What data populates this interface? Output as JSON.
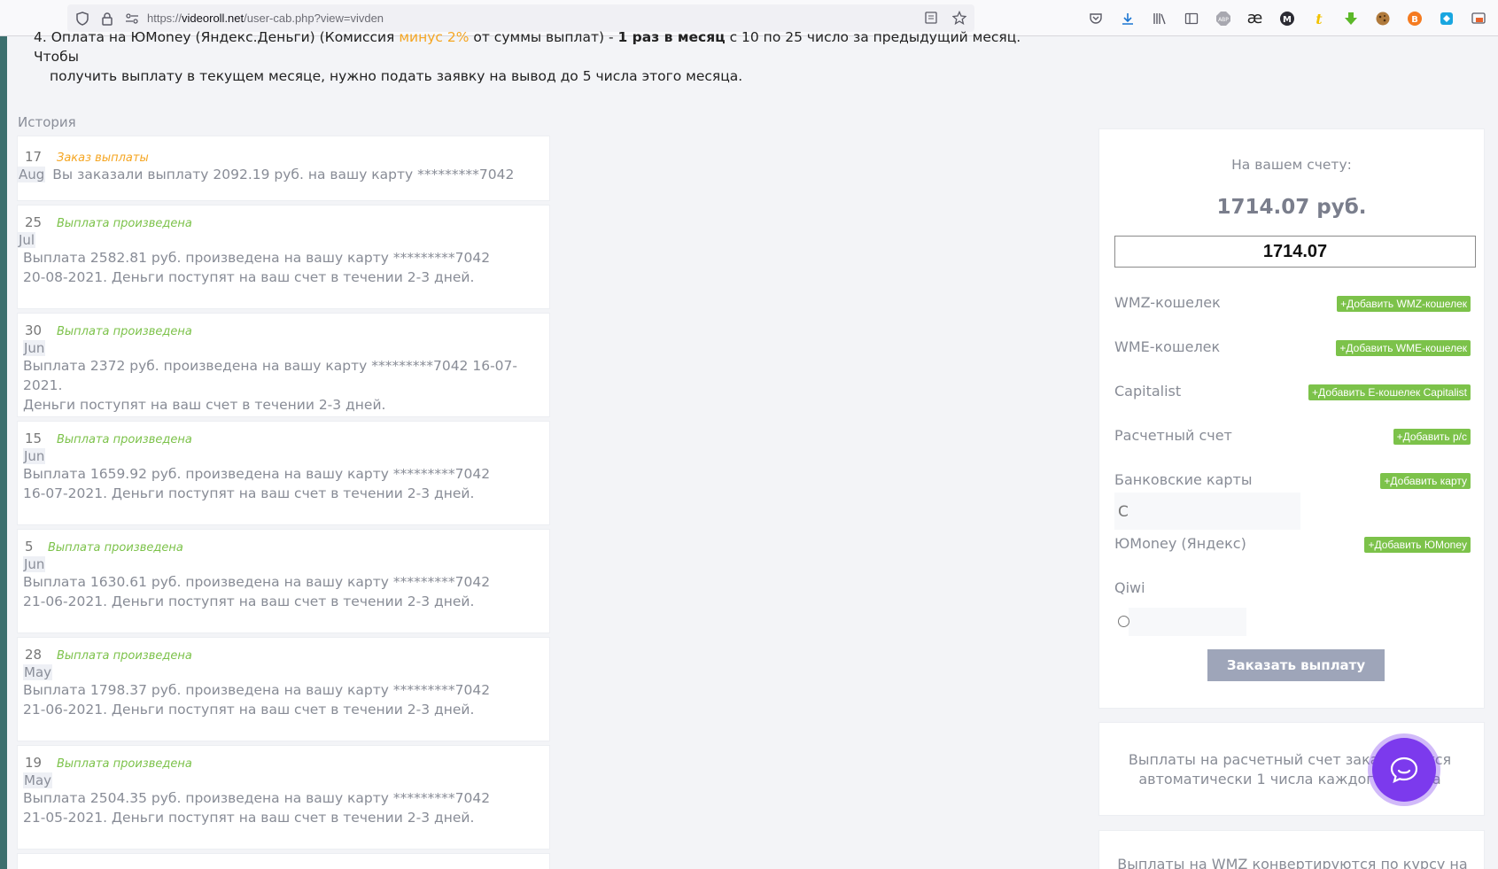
{
  "browser": {
    "url_prefix": "https://",
    "url_domain": "videoroll.net",
    "url_path": "/user-cab.php?view=vivden"
  },
  "notice": {
    "part1": "4. Оплата на ЮMoney (Яндекс.Деньги) (Комиссия ",
    "orange": "минус 2%",
    "part2": " от суммы выплат) - ",
    "bold": "1 раз в месяц",
    "part3": " с 10 по 25 число за предыдущий месяц. Чтобы",
    "line2": "получить выплату в текущем месяце, нужно подать заявку на вывод до 5 числа этого месяца."
  },
  "history": {
    "title": "История",
    "items": [
      {
        "day": "17",
        "month": "Aug",
        "status": "Заказ выплаты",
        "text1": "Вы заказали выплату 2092.19 руб. на вашу карту *********7042",
        "text2": ""
      },
      {
        "day": "25",
        "month": "Jul",
        "status": "Выплата произведена",
        "text1": "Выплата 2582.81 руб. произведена на вашу карту *********7042",
        "text2": "20-08-2021. Деньги поступят на ваш счет в течении 2-3 дней."
      },
      {
        "day": "30",
        "month": "Jun",
        "status": "Выплата произведена",
        "text1": "Выплата 2372 руб. произведена на вашу карту *********7042 16-07-2021.",
        "text2": "Деньги поступят на ваш счет в течении 2-3 дней."
      },
      {
        "day": "15",
        "month": "Jun",
        "status": "Выплата произведена",
        "text1": "Выплата 1659.92 руб. произведена на вашу карту *********7042",
        "text2": "16-07-2021. Деньги поступят на ваш счет в течении 2-3 дней."
      },
      {
        "day": "5",
        "month": "Jun",
        "status": "Выплата произведена",
        "text1": "Выплата 1630.61 руб. произведена на вашу карту *********7042",
        "text2": "21-06-2021. Деньги поступят на ваш счет в течении 2-3 дней."
      },
      {
        "day": "28",
        "month": "May",
        "status": "Выплата произведена",
        "text1": "Выплата 1798.37 руб. произведена на вашу карту *********7042",
        "text2": "21-06-2021. Деньги поступят на ваш счет в течении 2-3 дней."
      },
      {
        "day": "19",
        "month": "May",
        "status": "Выплата произведена",
        "text1": "Выплата 2504.35 руб. произведена на вашу карту *********7042",
        "text2": "21-05-2021. Деньги поступят на ваш счет в течении 2-3 дней."
      }
    ]
  },
  "account": {
    "balance_label": "На вашем счету:",
    "balance_value": "1714.07 руб.",
    "input_value": "1714.07",
    "wallets": [
      {
        "label": "WMZ-кошелек",
        "button": "+Добавить WMZ-кошелек"
      },
      {
        "label": "WME-кошелек",
        "button": "+Добавить WME-кошелек"
      },
      {
        "label": "Capitalist",
        "button": "+Добавить E-кошелек Capitalist"
      },
      {
        "label": "Расчетный счет",
        "button": "+Добавить р/с"
      },
      {
        "label": "Банковские карты",
        "button": "+Добавить карту"
      },
      {
        "label": "ЮMoney (Яндекс)",
        "button": "+Добавить ЮMoney"
      },
      {
        "label": "Qiwi",
        "button": ""
      }
    ],
    "card_radio_label": "С",
    "order_button": "Заказать выплату"
  },
  "info": {
    "card1_line1": "Выплаты на расчетный счет заказываются",
    "card1_line2": "автоматически 1 числа каждого месяца",
    "card2_text": "Выплаты на WMZ конвертируются по курсу на"
  },
  "colors": {
    "accent_green": "#7cc24a",
    "accent_orange": "#f5a623",
    "chat_purple": "#7c3aed"
  }
}
